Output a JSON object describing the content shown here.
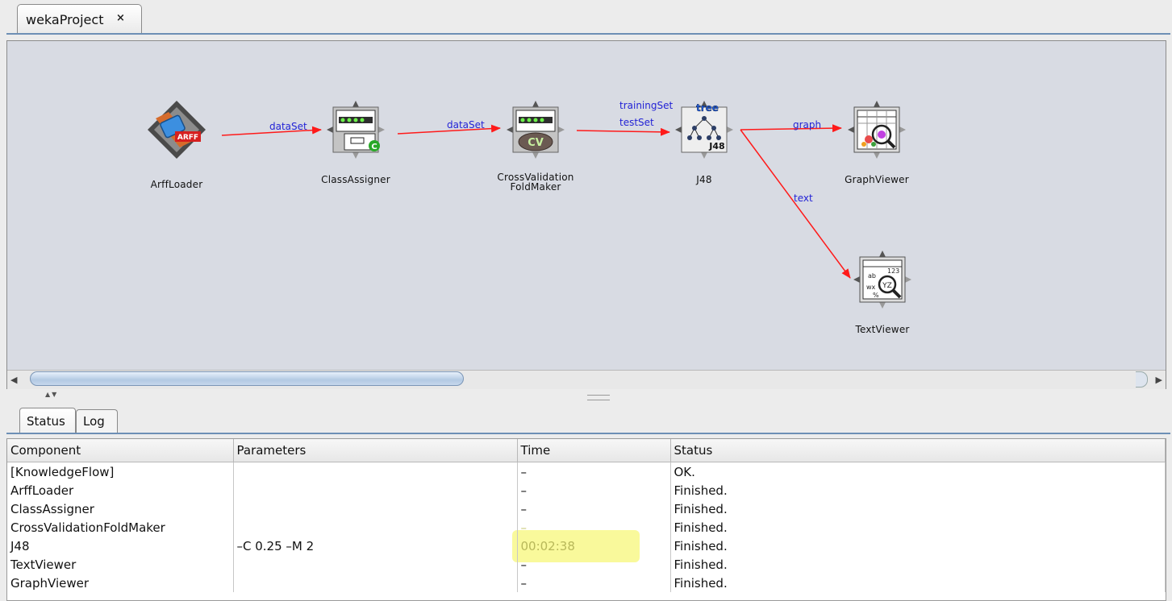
{
  "tabs": {
    "project_tab": "wekaProject",
    "close_glyph": "×"
  },
  "flow": {
    "components": [
      {
        "id": "arffloader",
        "label": "ArffLoader",
        "icon": "arff-loader-icon",
        "badge": "ARFF"
      },
      {
        "id": "classassigner",
        "label": "ClassAssigner",
        "icon": "class-assigner-icon",
        "badge": "C"
      },
      {
        "id": "cvfoldmaker",
        "label_line1": "CrossValidation",
        "label_line2": "FoldMaker",
        "icon": "cross-validation-icon",
        "badge": "CV"
      },
      {
        "id": "j48",
        "label": "J48",
        "icon": "j48-tree-icon",
        "badge": "J48",
        "badge2": "tree"
      },
      {
        "id": "graphviewer",
        "label": "GraphViewer",
        "icon": "graph-viewer-icon"
      },
      {
        "id": "textviewer",
        "label": "TextViewer",
        "icon": "text-viewer-icon",
        "badge": "ab 123 wx YZ %"
      }
    ],
    "connections": [
      {
        "label": "dataSet"
      },
      {
        "label": "dataSet"
      },
      {
        "label": "trainingSet"
      },
      {
        "label": "testSet"
      },
      {
        "label": "graph"
      },
      {
        "label": "text"
      }
    ]
  },
  "bottom_tabs": [
    "Status",
    "Log"
  ],
  "status_table": {
    "columns": [
      "Component",
      "Parameters",
      "Time",
      "Status"
    ],
    "rows": [
      [
        "[KnowledgeFlow]",
        "",
        "–",
        "OK."
      ],
      [
        "ArffLoader",
        "",
        "–",
        "Finished."
      ],
      [
        "ClassAssigner",
        "",
        "–",
        "Finished."
      ],
      [
        "CrossValidationFoldMaker",
        "",
        "–",
        "Finished."
      ],
      [
        "J48",
        "–C 0.25 –M 2",
        "00:02:38",
        "Finished."
      ],
      [
        "TextViewer",
        "",
        "–",
        "Finished."
      ],
      [
        "GraphViewer",
        "",
        "–",
        "Finished."
      ]
    ]
  },
  "colors": {
    "connection": "#ff1a1a",
    "connection_label": "#2323d6",
    "highlight": "#f7f779",
    "tab_underline": "#6d8fb5"
  }
}
